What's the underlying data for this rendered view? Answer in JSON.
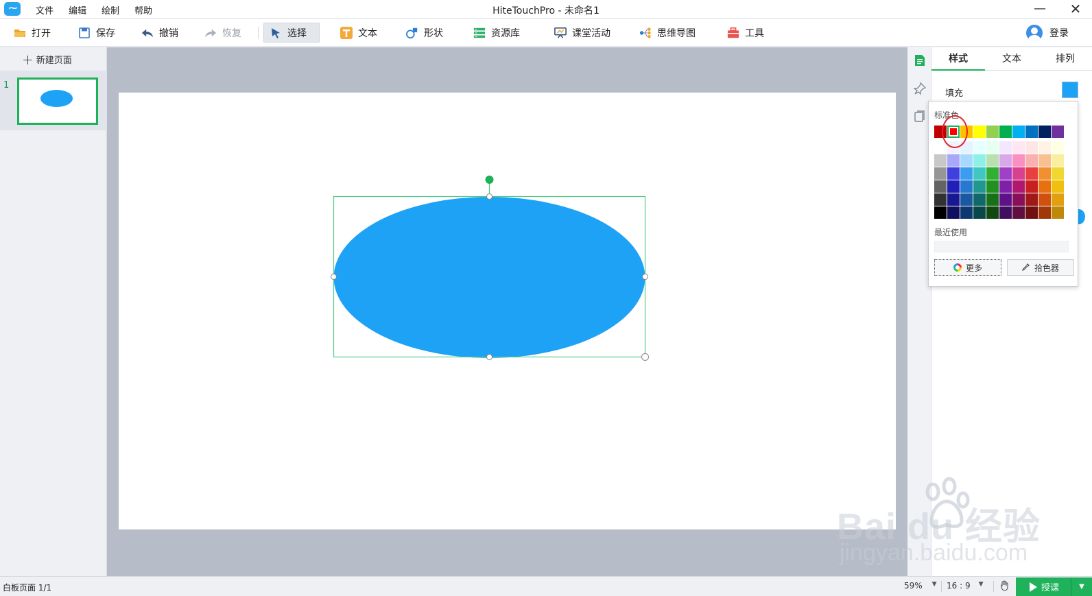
{
  "window": {
    "title": "HiteTouchPro - 未命名1",
    "minimize": "—",
    "close": "✕"
  },
  "menu": [
    "文件",
    "编辑",
    "绘制",
    "帮助"
  ],
  "toolbar": {
    "open": "打开",
    "save": "保存",
    "undo": "撤销",
    "redo": "恢复",
    "select": "选择",
    "text": "文本",
    "shape": "形状",
    "resources": "资源库",
    "activity": "课堂活动",
    "mindmap": "思维导图",
    "tools": "工具",
    "login": "登录"
  },
  "pages": {
    "new_page": "新建页面",
    "items": [
      {
        "number": "1"
      }
    ]
  },
  "props": {
    "tabs": [
      "样式",
      "文本",
      "排列"
    ],
    "active_tab": 0,
    "fill_label": "填充",
    "fill_color": "#1ea2f5"
  },
  "color_picker": {
    "standard_label": "标准色",
    "recent_label": "最近使用",
    "more_label": "更多",
    "eyedropper_label": "拾色器",
    "selected_index": 1,
    "standard_colors": [
      "#c00000",
      "#ff0000",
      "#ffc000",
      "#ffff00",
      "#92d050",
      "#00b050",
      "#00b0f0",
      "#0070c0",
      "#002060",
      "#7030a0"
    ],
    "grid_colors": [
      [
        "#ffffff",
        "#f2f2ff",
        "#e6f2ff",
        "#e6ffff",
        "#e6fff0",
        "#f3e6ff",
        "#ffe6f2",
        "#ffe6e6",
        "#fff3e6",
        "#ffffe6"
      ],
      [
        "#c8c8c8",
        "#a8a8f8",
        "#a8d8ff",
        "#8ff0e8",
        "#b8e0b0",
        "#d8a8e8",
        "#f890c0",
        "#f8b0b0",
        "#f8c090",
        "#f8f0a0"
      ],
      [
        "#969696",
        "#4040e0",
        "#3c9cf0",
        "#40c8c0",
        "#30b030",
        "#a040c8",
        "#d84090",
        "#e84040",
        "#f09030",
        "#f0d830"
      ],
      [
        "#646464",
        "#2020b8",
        "#2878d0",
        "#209890",
        "#209020",
        "#8020a8",
        "#b01870",
        "#c82020",
        "#e87010",
        "#f0c010"
      ],
      [
        "#323232",
        "#181890",
        "#1c58a0",
        "#106868",
        "#187018",
        "#601088",
        "#881058",
        "#a01818",
        "#d05010",
        "#e0a010"
      ],
      [
        "#000000",
        "#101060",
        "#103870",
        "#084848",
        "#104810",
        "#401060",
        "#601040",
        "#701010",
        "#a03808",
        "#c08808"
      ]
    ]
  },
  "canvas": {
    "shape_color": "#1ea2f5",
    "selection_color": "#2fbf71",
    "rotate_handle_color": "#1db159"
  },
  "watermark": {
    "brand": "Bai du 经验",
    "url": "jingyan.baidu.com"
  },
  "status": {
    "page_info": "白板页面 1/1",
    "zoom": "59%",
    "ratio": "16 : 9",
    "teach": "授课"
  }
}
